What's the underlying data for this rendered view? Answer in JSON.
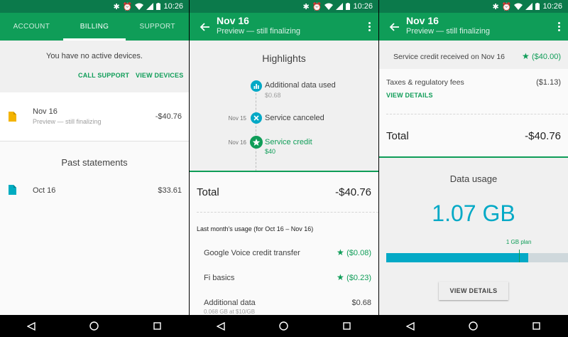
{
  "status": {
    "time": "10:26"
  },
  "screen1": {
    "tabs": [
      "ACCOUNT",
      "BILLING",
      "SUPPORT"
    ],
    "active_tab": 1,
    "no_devices": "You have no active devices.",
    "call_support": "CALL SUPPORT",
    "view_devices": "VIEW DEVICES",
    "current": {
      "title": "Nov 16",
      "subtitle": "Preview — still finalizing",
      "amount": "-$40.76",
      "icon_color": "#f4b400"
    },
    "past_heading": "Past statements",
    "past": [
      {
        "title": "Oct 16",
        "amount": "$33.61",
        "icon_color": "#00acc1"
      }
    ]
  },
  "screen2": {
    "title": "Nov 16",
    "subtitle": "Preview — still finalizing",
    "highlights_heading": "Highlights",
    "highlights": [
      {
        "date": "",
        "label": "Additional data used",
        "sub": "$0.68",
        "icon": "bar-chart-icon",
        "color": "#03a9c6"
      },
      {
        "date": "Nov 15",
        "label": "Service canceled",
        "sub": "",
        "icon": "close-icon",
        "color": "#03a9c6"
      },
      {
        "date": "Nov 16",
        "label": "Service credit",
        "sub": "$40",
        "icon": "star-icon",
        "color": "#0f9d58"
      }
    ],
    "total_label": "Total",
    "total_amount": "-$40.76",
    "usage_heading": "Last month's usage (for Oct 16 – Nov 16)",
    "rows": [
      {
        "label": "Google Voice credit transfer",
        "amount": "($0.08)",
        "star": true
      },
      {
        "label": "Fi basics",
        "amount": "($0.23)",
        "star": true
      },
      {
        "label": "Additional data",
        "sub": "0.068 GB at $10/GB",
        "amount": "$0.68",
        "star": false
      }
    ]
  },
  "screen3": {
    "title": "Nov 16",
    "subtitle": "Preview — still finalizing",
    "credit_label": "Service credit received on Nov 16",
    "credit_amount": "($40.00)",
    "taxes_label": "Taxes & regulatory fees",
    "taxes_amount": "($1.13)",
    "view_details_link": "VIEW DETAILS",
    "total_label": "Total",
    "total_amount": "-$40.76",
    "data_heading": "Data usage",
    "data_amount": "1.07 GB",
    "plan_label": "1 GB plan",
    "usage_fraction": 0.78,
    "plan_fraction": 0.73,
    "view_details_button": "VIEW DETAILS"
  },
  "colors": {
    "primary": "#0f9d58",
    "primary_dark": "#0b7a4b",
    "accent": "#03a9c6"
  }
}
